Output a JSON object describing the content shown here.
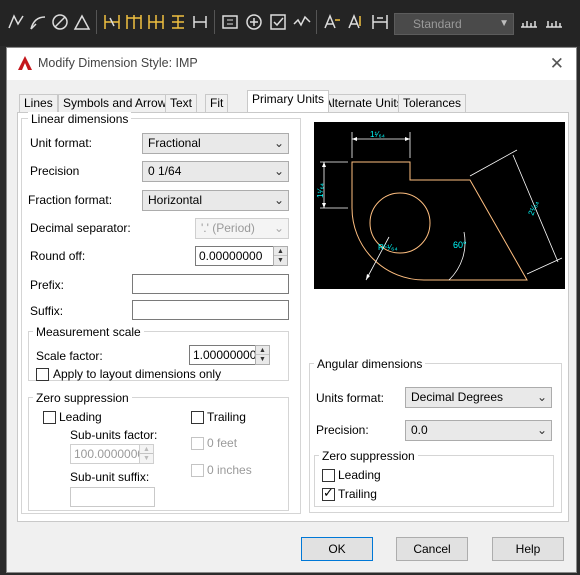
{
  "toolbar": {
    "style_combo": "Standard",
    "icons": [
      "linear-dim-icon",
      "aligned-dim-icon",
      "angular-dim-icon",
      "arc-length-icon",
      "quick-dim-icon",
      "baseline-dim-icon",
      "continue-dim-icon",
      "ordinate-dim-icon",
      "tolerance-icon",
      "center-mark-icon",
      "inspect-icon",
      "jogged-linear-icon",
      "dim-edit-icon",
      "dim-text-edit-icon",
      "dim-update-icon",
      "dim-style-icon"
    ]
  },
  "dialog": {
    "title": "Modify Dimension Style: IMP",
    "tabs": [
      "Lines",
      "Symbols and Arrows",
      "Text",
      "Fit",
      "Primary Units",
      "Alternate Units",
      "Tolerances"
    ],
    "active_tab": "Primary Units"
  },
  "linear": {
    "group_label": "Linear dimensions",
    "unit_format_label": "Unit format:",
    "unit_format_value": "Fractional",
    "precision_label": "Precision",
    "precision_value": "0 1/64",
    "fraction_format_label": "Fraction format:",
    "fraction_format_value": "Horizontal",
    "decimal_sep_label": "Decimal separator:",
    "decimal_sep_value": "'.' (Period)",
    "round_off_label": "Round off:",
    "round_off_value": "0.00000000",
    "prefix_label": "Prefix:",
    "prefix_value": "",
    "suffix_label": "Suffix:",
    "suffix_value": ""
  },
  "measurement": {
    "group_label": "Measurement scale",
    "scale_factor_label": "Scale factor:",
    "scale_factor_value": "1.00000000",
    "layout_only_label": "Apply to layout dimensions only",
    "layout_only_checked": false
  },
  "zero_suppression": {
    "group_label": "Zero suppression",
    "leading_label": "Leading",
    "leading_checked": false,
    "trailing_label": "Trailing",
    "trailing_checked": false,
    "sub_units_factor_label": "Sub-units factor:",
    "sub_units_factor_value": "100.0000000",
    "sub_unit_suffix_label": "Sub-unit suffix:",
    "sub_unit_suffix_value": "",
    "feet_label": "0 feet",
    "inches_label": "0 inches"
  },
  "preview": {
    "top_dim": "1¹⁄₆₄",
    "left_dim": "1¹⁄₆₄",
    "right_dim": "2¹⁄₆₄",
    "radius_dim": "R⁵¹⁄₆₄",
    "angle_dim": "60°"
  },
  "angular": {
    "group_label": "Angular dimensions",
    "units_format_label": "Units format:",
    "units_format_value": "Decimal Degrees",
    "precision_label": "Precision:",
    "precision_value": "0.0",
    "zero_group_label": "Zero suppression",
    "leading_label": "Leading",
    "leading_checked": false,
    "trailing_label": "Trailing",
    "trailing_checked": true
  },
  "buttons": {
    "ok": "OK",
    "cancel": "Cancel",
    "help": "Help"
  },
  "colors": {
    "dialog_bg": "#f0f0f0",
    "toolbar_bg": "#242424",
    "preview_bg": "#000000",
    "dim_text": "#00ffff",
    "geometry": "#ffbf80"
  }
}
